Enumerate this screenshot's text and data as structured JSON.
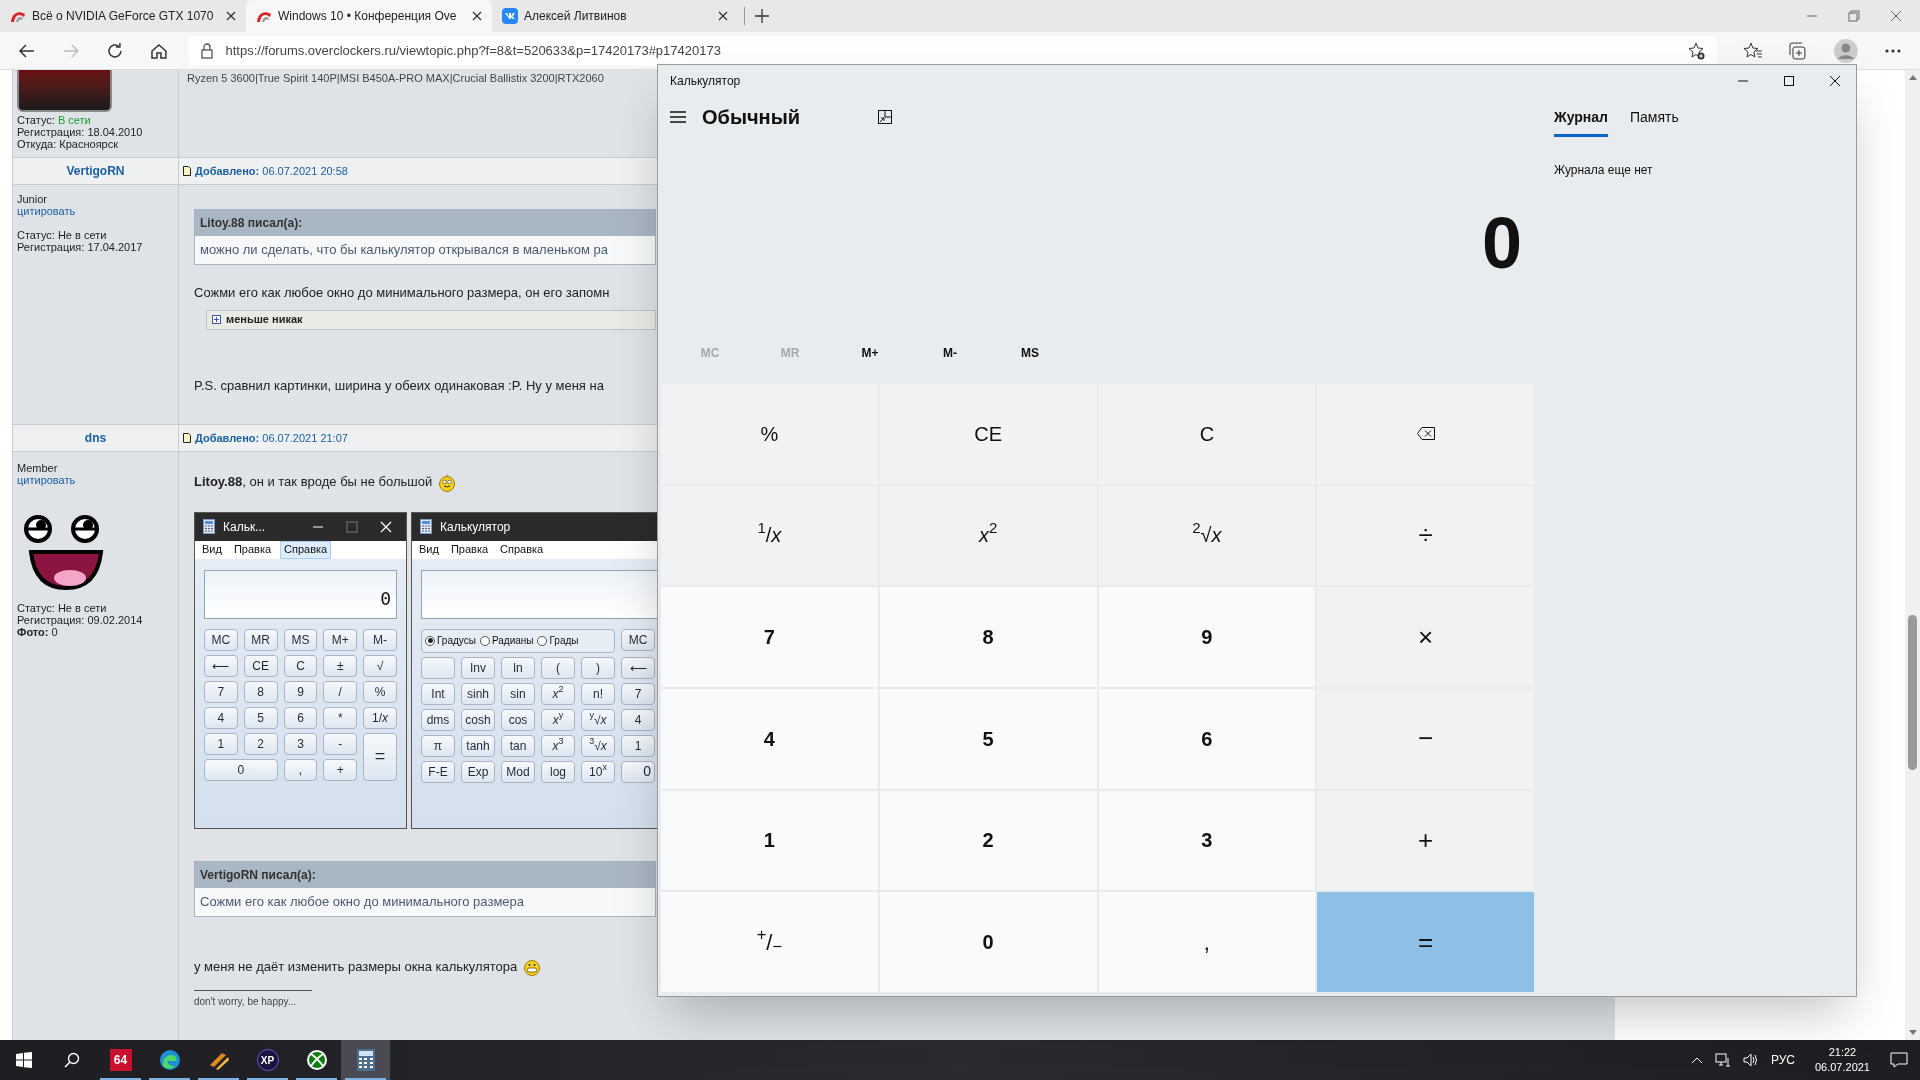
{
  "browser": {
    "tabs": [
      {
        "title": "Всё о NVIDIA GeForce GTX 1070",
        "selected": false,
        "kind": "forum"
      },
      {
        "title": "Windows 10 • Конференция Ove",
        "selected": true,
        "kind": "forum"
      },
      {
        "title": "Алексей Литвинов",
        "selected": false,
        "kind": "vk"
      }
    ],
    "url": "https://forums.overclockers.ru/viewtopic.php?f=8&t=520633&p=17420173#p17420173"
  },
  "forum": {
    "post_top": {
      "status_label": "Статус:",
      "status": "В сети",
      "online": true,
      "registration": "Регистрация: 18.04.2010",
      "location": "Откуда: Красноярск",
      "signature": "Ryzen 5 3600|True Spirit 140P|MSI B450A-PRO MAX|Crucial Ballistix 3200|RTX2060"
    },
    "post_vertigo": {
      "author": "VertigoRN",
      "added_label": "Добавлено:",
      "date": "06.07.2021 20:58",
      "rank": "Junior",
      "quote_link": "цитировать",
      "status_label": "Статус:",
      "status": "Не в сети",
      "online": false,
      "registration": "Регистрация: 17.04.2017",
      "quote": {
        "header": "Litoy.88 писал(а):",
        "text": "можно ли сделать, что бы калькулятор открывался в маленьком ра"
      },
      "text": "Сожми его как любое окно до минимального размера, он его запомн",
      "spoiler": {
        "label": "меньше никак",
        "expanded": false
      },
      "ps": "P.S. сравнил картинки, ширина у обеих одинаковая :P. Ну у меня на"
    },
    "post_dns": {
      "author": "dns",
      "added_label": "Добавлено:",
      "date": "06.07.2021 21:07",
      "rank": "Member",
      "quote_link": "цитировать",
      "status_label": "Статус:",
      "status": "Не в сети",
      "online": false,
      "registration": "Регистрация: 09.02.2014",
      "photo_label": "Фото:",
      "photo": "0",
      "text": "**Litoy.88**, он и так вроде бы не большой",
      "calc_small": {
        "title": "Кальк...",
        "menu": [
          {
            "label": "Вид",
            "highlighted": false
          },
          {
            "label": "Правка",
            "highlighted": false
          },
          {
            "label": "Справка",
            "highlighted": true
          }
        ],
        "display": "0",
        "keys": [
          {
            "label": "MC",
            "kind": "key"
          },
          {
            "label": "MR",
            "kind": "key"
          },
          {
            "label": "MS",
            "kind": "key"
          },
          {
            "label": "M+",
            "kind": "key"
          },
          {
            "label": "M-",
            "kind": "key"
          },
          {
            "label": "⟵",
            "kind": "key"
          },
          {
            "label": "CE",
            "kind": "key"
          },
          {
            "label": "C",
            "kind": "key"
          },
          {
            "label": "±",
            "kind": "key"
          },
          {
            "label": "√",
            "kind": "key"
          },
          {
            "label": "7",
            "kind": "key"
          },
          {
            "label": "8",
            "kind": "key"
          },
          {
            "label": "9",
            "kind": "key"
          },
          {
            "label": "/",
            "kind": "key"
          },
          {
            "label": "%",
            "kind": "key"
          },
          {
            "label": "4",
            "kind": "key"
          },
          {
            "label": "5",
            "kind": "key"
          },
          {
            "label": "6",
            "kind": "key"
          },
          {
            "label": "*",
            "kind": "key"
          },
          {
            "label": "1/*x*",
            "kind": "key"
          },
          {
            "label": "1",
            "kind": "key"
          },
          {
            "label": "2",
            "kind": "key"
          },
          {
            "label": "3",
            "kind": "key"
          },
          {
            "label": "-",
            "kind": "key"
          },
          {
            "label": "=",
            "kind": "tall"
          },
          {
            "label": "0",
            "kind": "wide"
          },
          {
            "label": ",",
            "kind": "key"
          },
          {
            "label": "+",
            "kind": "key"
          }
        ]
      },
      "calc_big": {
        "title": "Калькулятор",
        "menu": [
          {
            "label": "Вид",
            "highlighted": false
          },
          {
            "label": "Правка",
            "highlighted": false
          },
          {
            "label": "Справка",
            "highlighted": false
          }
        ],
        "angles": [
          {
            "label": "Градусы",
            "checked": true
          },
          {
            "label": "Радианы",
            "checked": false
          },
          {
            "label": "Грады",
            "checked": false
          }
        ],
        "keys": [
          {
            "label": "MC",
            "kind": "key"
          },
          {
            "kind": "blank"
          },
          {
            "label": "Inv",
            "kind": "key"
          },
          {
            "label": "ln",
            "kind": "key"
          },
          {
            "label": "(",
            "kind": "key"
          },
          {
            "label": ")",
            "kind": "key"
          },
          {
            "label": "⟵",
            "kind": "key"
          },
          {
            "label": "Int",
            "kind": "key"
          },
          {
            "label": "sinh",
            "kind": "key"
          },
          {
            "label": "sin",
            "kind": "key"
          },
          {
            "label": "*x*$^{2}$",
            "kind": "key"
          },
          {
            "label": "n!",
            "kind": "key"
          },
          {
            "label": "7",
            "kind": "key"
          },
          {
            "label": "dms",
            "kind": "key"
          },
          {
            "label": "cosh",
            "kind": "key"
          },
          {
            "label": "cos",
            "kind": "key"
          },
          {
            "label": "*x*$^{y}$",
            "kind": "key"
          },
          {
            "label": "$^{y}$√*x*",
            "kind": "key"
          },
          {
            "label": "4",
            "kind": "key"
          },
          {
            "label": "π",
            "kind": "key"
          },
          {
            "label": "tanh",
            "kind": "key"
          },
          {
            "label": "tan",
            "kind": "key"
          },
          {
            "label": "*x*$^{3}$",
            "kind": "key"
          },
          {
            "label": "$^{3}$√*x*",
            "kind": "key"
          },
          {
            "label": "1",
            "kind": "key"
          },
          {
            "label": "F-E",
            "kind": "key"
          },
          {
            "label": "Exp",
            "kind": "key"
          },
          {
            "label": "Mod",
            "kind": "key"
          },
          {
            "label": "log",
            "kind": "key"
          },
          {
            "label": "10$^{x}$",
            "kind": "key"
          },
          {
            "label": "0",
            "kind": "cut"
          }
        ]
      },
      "quote": {
        "header": "VertigoRN писал(а):",
        "text": "Сожми его как любое окно до минимального размера"
      },
      "text2": "у меня не даёт изменить размеры окна калькулятора",
      "signature": "don't worry, be happy..."
    }
  },
  "calculator": {
    "title": "Калькулятор",
    "mode": "Обычный",
    "display": "0",
    "memory": [
      {
        "label": "MC",
        "disabled": true
      },
      {
        "label": "MR",
        "disabled": true
      },
      {
        "label": "M+",
        "disabled": false
      },
      {
        "label": "M-",
        "disabled": false
      },
      {
        "label": "MS",
        "disabled": false
      }
    ],
    "keys": [
      {
        "label": "%",
        "kind": "func"
      },
      {
        "label": "CE",
        "kind": "func"
      },
      {
        "label": "C",
        "kind": "func"
      },
      {
        "kind": "backspace"
      },
      {
        "label": "$^{1}$/*x*",
        "kind": "func"
      },
      {
        "label": "*x*$^{2}$",
        "kind": "func"
      },
      {
        "label": "$^{2}$√*x*",
        "kind": "func"
      },
      {
        "label": "÷",
        "kind": "op"
      },
      {
        "label": "7",
        "kind": "digit"
      },
      {
        "label": "8",
        "kind": "digit"
      },
      {
        "label": "9",
        "kind": "digit"
      },
      {
        "label": "×",
        "kind": "op"
      },
      {
        "label": "4",
        "kind": "digit"
      },
      {
        "label": "5",
        "kind": "digit"
      },
      {
        "label": "6",
        "kind": "digit"
      },
      {
        "label": "−",
        "kind": "op"
      },
      {
        "label": "1",
        "kind": "digit"
      },
      {
        "label": "2",
        "kind": "digit"
      },
      {
        "label": "3",
        "kind": "digit"
      },
      {
        "label": "+",
        "kind": "op"
      },
      {
        "label": "$^{+}$/$_{−}$",
        "kind": "sign"
      },
      {
        "label": "0",
        "kind": "digit"
      },
      {
        "label": ",",
        "kind": "sign"
      },
      {
        "label": "=",
        "kind": "equals"
      }
    ],
    "panel_tabs": [
      {
        "label": "Журнал",
        "selected": true
      },
      {
        "label": "Память",
        "selected": false
      }
    ],
    "history_empty": "Журнала еще нет"
  },
  "taskbar": {
    "apps": [
      {
        "kind": "aida",
        "label": "64",
        "running": true,
        "active": false
      },
      {
        "kind": "browser",
        "running": true,
        "active": false
      },
      {
        "kind": "tool",
        "running": true,
        "active": false
      },
      {
        "kind": "xp",
        "label": "XP",
        "running": true,
        "active": false
      },
      {
        "kind": "xbox",
        "running": true,
        "active": false
      },
      {
        "kind": "calculator",
        "running": true,
        "active": true
      }
    ],
    "language": "РУС",
    "time": "21:22",
    "date": "06.07.2021"
  }
}
